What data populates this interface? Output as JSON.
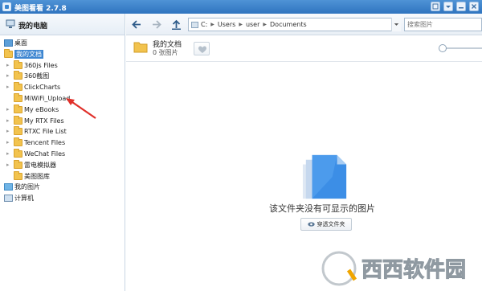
{
  "window": {
    "title": "美图看看 2.7.8"
  },
  "sidebar": {
    "header": "我的电脑",
    "tree": [
      {
        "label": "桌面",
        "icon": "desktop-icon",
        "level": 0
      },
      {
        "label": "我的文档",
        "icon": "folder-icon",
        "level": 0,
        "selected": true
      },
      {
        "label": "360js Files",
        "icon": "folder-icon",
        "level": 1
      },
      {
        "label": "360截图",
        "icon": "folder-icon",
        "level": 1
      },
      {
        "label": "ClickCharts",
        "icon": "folder-icon",
        "level": 1
      },
      {
        "label": "MiWiFi_Upload",
        "icon": "folder-icon",
        "level": 1
      },
      {
        "label": "My eBooks",
        "icon": "folder-icon",
        "level": 1
      },
      {
        "label": "My RTX Files",
        "icon": "folder-icon",
        "level": 1
      },
      {
        "label": "RTXC File List",
        "icon": "folder-icon",
        "level": 1
      },
      {
        "label": "Tencent Files",
        "icon": "folder-icon",
        "level": 1
      },
      {
        "label": "WeChat Files",
        "icon": "folder-icon",
        "level": 1
      },
      {
        "label": "雷电模拟器",
        "icon": "folder-icon",
        "level": 1
      },
      {
        "label": "美图图库",
        "icon": "folder-icon",
        "level": 1
      },
      {
        "label": "我的图片",
        "icon": "pictures-icon",
        "level": 0
      },
      {
        "label": "计算机",
        "icon": "computer-icon",
        "level": 0
      }
    ]
  },
  "toolbar": {
    "address": [
      "C:",
      "Users",
      "user",
      "Documents"
    ],
    "search_placeholder": "搜索图片"
  },
  "folder": {
    "title": "我的文档",
    "count": "0 张图片"
  },
  "main": {
    "empty_message": "该文件夹没有可显示的图片",
    "open_button": "穿透文件夹"
  },
  "watermark": {
    "text": "西西软件园"
  },
  "colors": {
    "titlebar": "#3a82cc",
    "selection": "#3e86d1",
    "folder": "#f2c34e",
    "arrow": "#e0302a"
  }
}
